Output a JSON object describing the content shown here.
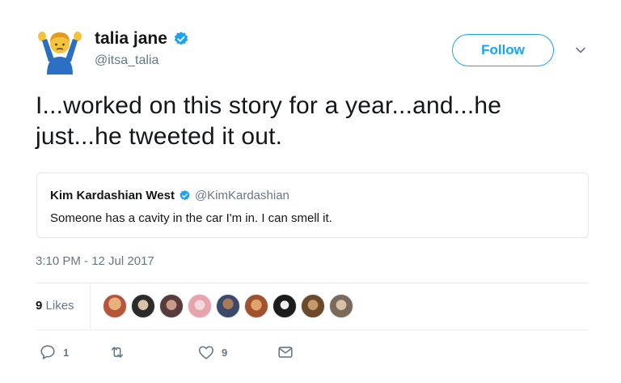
{
  "author": {
    "name": "talia jane",
    "handle": "@itsa_talia",
    "avatar_icon": "person-shrugging-emoji",
    "verified": true
  },
  "header": {
    "follow_label": "Follow",
    "menu_icon": "chevron-down-icon"
  },
  "tweet": {
    "text": "I...worked on this story for a year...and...he just...he tweeted it out."
  },
  "quoted": {
    "name": "Kim Kardashian West",
    "handle": "@KimKardashian",
    "text": "Someone has a cavity in the car I'm in. I can smell it.",
    "verified": true
  },
  "timestamp": "3:10 PM - 12 Jul 2017",
  "likes": {
    "count": "9",
    "label": "Likes",
    "liker_avatars": [
      {
        "icon": "avatar-1",
        "color": "#b5563c"
      },
      {
        "icon": "avatar-2",
        "color": "#2b2b2b"
      },
      {
        "icon": "avatar-3",
        "color": "#5a3b3b"
      },
      {
        "icon": "avatar-4",
        "color": "#e8a3ad"
      },
      {
        "icon": "avatar-5",
        "color": "#3b4a6b"
      },
      {
        "icon": "avatar-6",
        "color": "#a0522d"
      },
      {
        "icon": "avatar-7",
        "color": "#1c1c1c"
      },
      {
        "icon": "avatar-8",
        "color": "#6b4a2b"
      },
      {
        "icon": "avatar-9",
        "color": "#7a6a5a"
      }
    ]
  },
  "actions": {
    "reply_count": "1",
    "retweet_count": "",
    "like_count": "9",
    "icons": [
      "reply-icon",
      "retweet-icon",
      "heart-icon",
      "message-icon"
    ]
  },
  "colors": {
    "accent": "#1da1f2",
    "secondary_text": "#657786",
    "border": "#e1e8ed"
  }
}
